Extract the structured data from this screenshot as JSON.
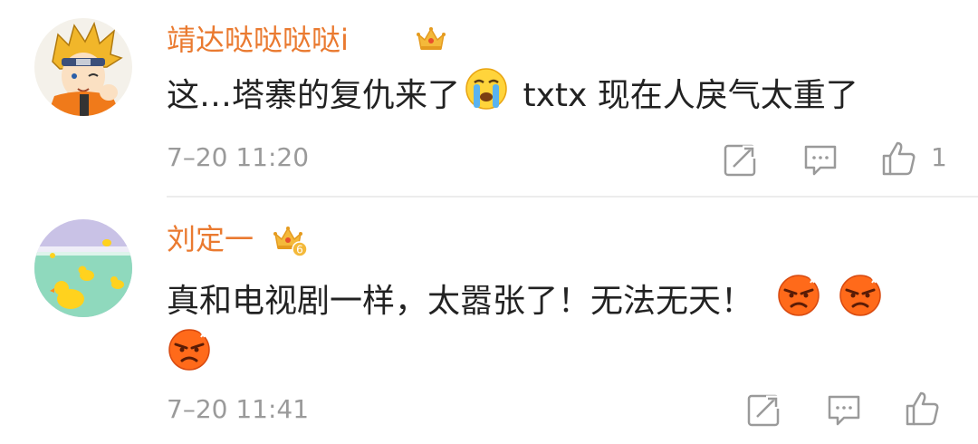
{
  "comments": [
    {
      "username": "靖达哒哒哒哒i",
      "text_before": "这…塔寨的复仇来了",
      "emoji": "crying-face-emoji",
      "text_after": " txtx 现在人戾气太重了",
      "time": "7–20 11:20",
      "likes": "1",
      "badge": "crown-badge"
    },
    {
      "username": "刘定一",
      "text": "真和电视剧一样，太嚣张了！无法无天！",
      "emoji": "angry-face-emoji",
      "time": "7–20 11:41",
      "likes": "",
      "badge": "crown-badge-6",
      "badge_level": "6"
    }
  ],
  "colors": {
    "username": "#ea7a30",
    "text": "#222222",
    "meta": "#9a9a9a",
    "divider": "#ececec"
  }
}
